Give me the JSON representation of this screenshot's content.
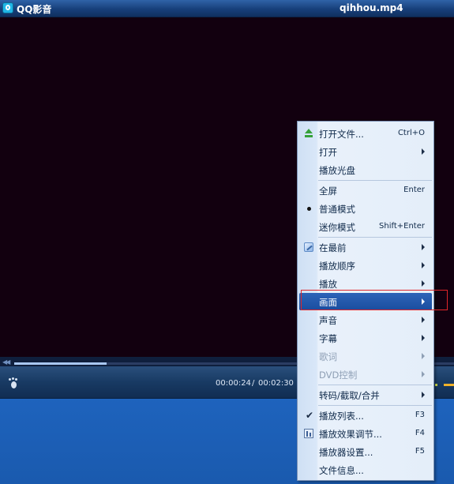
{
  "window": {
    "app_title": "QQ影音",
    "file_title": "qihhou.mp4"
  },
  "player": {
    "time_current": "00:00:24",
    "time_separator": "/",
    "time_total": "00:02:30",
    "progress_fraction": 0.21
  },
  "menu": {
    "items": [
      {
        "label": "打开文件...",
        "shortcut": "Ctrl+O",
        "icon": "eject-icon"
      },
      {
        "label": "打开",
        "submenu": true
      },
      {
        "label": "播放光盘"
      },
      {
        "label": "全屏",
        "shortcut": "Enter"
      },
      {
        "label": "普通模式",
        "icon": "radio-dot-icon"
      },
      {
        "label": "迷你模式",
        "shortcut": "Shift+Enter"
      },
      {
        "label": "在最前",
        "submenu": true,
        "icon": "pin-icon"
      },
      {
        "label": "播放顺序",
        "submenu": true
      },
      {
        "label": "播放",
        "submenu": true
      },
      {
        "label": "画面",
        "submenu": true,
        "highlighted": true
      },
      {
        "label": "声音",
        "submenu": true
      },
      {
        "label": "字幕",
        "submenu": true
      },
      {
        "label": "歌词",
        "submenu": true,
        "disabled": true
      },
      {
        "label": "DVD控制",
        "submenu": true,
        "disabled": true
      },
      {
        "label": "转码/截取/合并",
        "submenu": true
      },
      {
        "label": "播放列表...",
        "shortcut": "F3",
        "icon": "check-icon"
      },
      {
        "label": "播放效果调节...",
        "shortcut": "F4",
        "icon": "equalizer-icon"
      },
      {
        "label": "播放器设置...",
        "shortcut": "F5"
      },
      {
        "label": "文件信息..."
      }
    ]
  },
  "colors": {
    "highlight": "#1f55a8",
    "annotation_box": "#e0262a",
    "video_background": "#12000f"
  }
}
